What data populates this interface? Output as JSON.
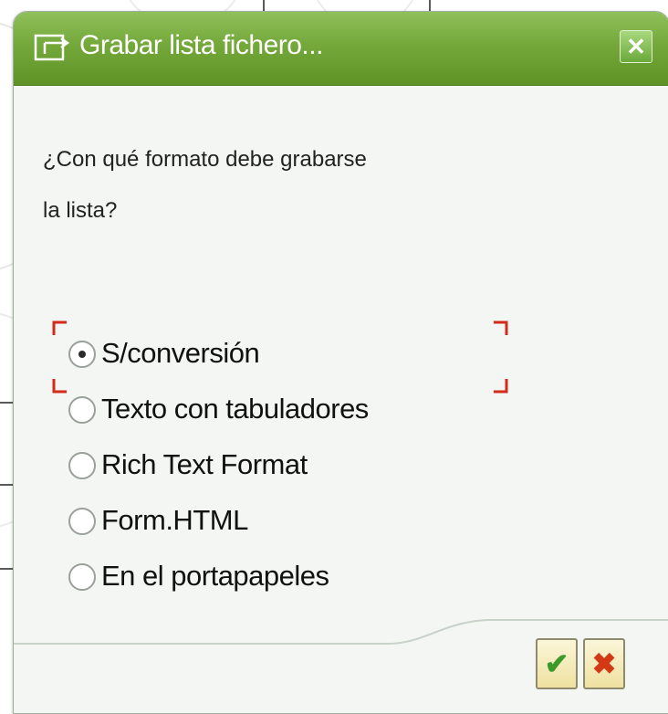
{
  "window": {
    "title": "Grabar lista fichero...",
    "title_icon": "save-file-icon",
    "close_icon": "close-icon"
  },
  "question": {
    "line1": "¿Con qué formato debe grabarse",
    "line2": "la lista?"
  },
  "options": [
    {
      "label": "S/conversión",
      "selected": true
    },
    {
      "label": "Texto con tabuladores",
      "selected": false
    },
    {
      "label": "Rich Text Format",
      "selected": false
    },
    {
      "label": "Form.HTML",
      "selected": false
    },
    {
      "label": "En el portapapeles",
      "selected": false
    }
  ],
  "buttons": {
    "ok_icon": "checkmark-icon",
    "ok_glyph": "✔",
    "cancel_icon": "cancel-x-icon",
    "cancel_glyph": "✖"
  },
  "colors": {
    "titlebar": "#74a83a",
    "focus_frame": "#d42a1a",
    "ok": "#3c9a2a",
    "cancel": "#d23a16"
  }
}
